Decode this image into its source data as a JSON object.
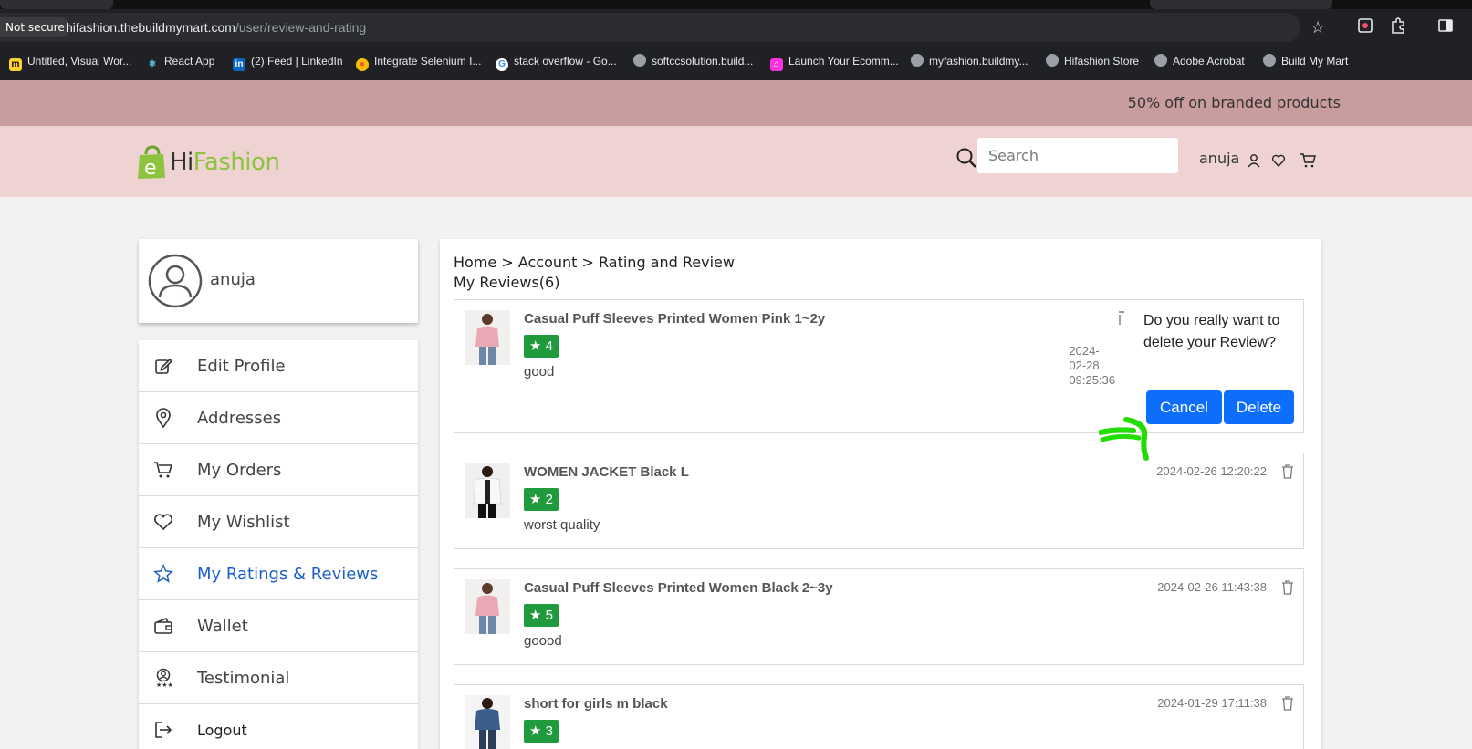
{
  "browser": {
    "security_label": "Not secure",
    "url_host": "hifashion.thebuildmymart.com",
    "url_path": "/user/review-and-rating",
    "bookmarks": [
      {
        "label": "Untitled, Visual Wor...",
        "icon": "miro-icon"
      },
      {
        "label": "React App",
        "icon": "react-icon"
      },
      {
        "label": "(2) Feed | LinkedIn",
        "icon": "linkedin-icon"
      },
      {
        "label": "Integrate Selenium I...",
        "icon": "chrome-icon"
      },
      {
        "label": "stack overflow - Go...",
        "icon": "google-icon"
      },
      {
        "label": "softccsolution.build...",
        "icon": "globe-icon"
      },
      {
        "label": "Launch Your Ecomm...",
        "icon": "shop-icon"
      },
      {
        "label": "myfashion.buildmy...",
        "icon": "globe-icon"
      },
      {
        "label": "Hifashion Store",
        "icon": "globe-icon"
      },
      {
        "label": "Adobe Acrobat",
        "icon": "globe-icon"
      },
      {
        "label": "Build My Mart",
        "icon": "globe-icon"
      }
    ]
  },
  "promo": {
    "text": "50% off on branded products"
  },
  "header": {
    "logo_hi": "Hi",
    "logo_fashion": "Fashion",
    "logo_letter": "e",
    "search_placeholder": "Search",
    "username": "anuja"
  },
  "profile": {
    "name": "anuja"
  },
  "menu": [
    {
      "label": "Edit Profile",
      "icon": "edit-icon"
    },
    {
      "label": "Addresses",
      "icon": "location-pin-icon"
    },
    {
      "label": "My Orders",
      "icon": "cart-icon"
    },
    {
      "label": "My Wishlist",
      "icon": "heart-icon"
    },
    {
      "label": "My Ratings & Reviews",
      "icon": "star-icon",
      "active": true
    },
    {
      "label": "Wallet",
      "icon": "wallet-icon"
    },
    {
      "label": "Testimonial",
      "icon": "testimonial-icon"
    },
    {
      "label": "Logout",
      "icon": "logout-icon"
    }
  ],
  "main": {
    "breadcrumb": "Home > Account > Rating and Review",
    "title": "My Reviews(6)",
    "reviews": [
      {
        "title": "Casual Puff Sleeves Printed Women Pink 1~2y",
        "rating": "4",
        "text": "good",
        "date": "2024-\n02-28\n09:25:36"
      },
      {
        "title": "WOMEN JACKET Black L",
        "rating": "2",
        "text": "worst quality",
        "date": "2024-02-26 12:20:22"
      },
      {
        "title": "Casual Puff Sleeves Printed Women Black 2~3y",
        "rating": "5",
        "text": "goood",
        "date": "2024-02-26 11:43:38"
      },
      {
        "title": "short for girls m black",
        "rating": "3",
        "text": "",
        "date": "2024-01-29 17:11:38"
      }
    ],
    "star_glyph": "★"
  },
  "confirm": {
    "message": "Do you really want to delete your Review?",
    "cancel_label": "Cancel",
    "delete_label": "Delete"
  },
  "colors": {
    "promo_bg": "#c99c9d",
    "header_bg": "#efd3d3",
    "accent_blue": "#0d6efd",
    "rating_green": "#1f9a3d",
    "logo_green": "#8dc33f",
    "annotation_green": "#22dd00"
  }
}
